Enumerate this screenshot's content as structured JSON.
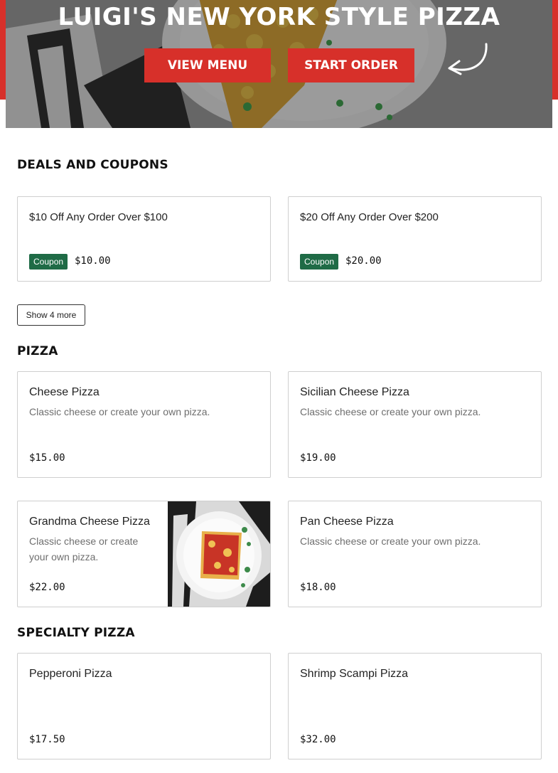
{
  "hero": {
    "title": "LUIGI'S NEW YORK STYLE PIZZA",
    "view_menu_label": "VIEW MENU",
    "start_order_label": "START ORDER"
  },
  "deals": {
    "title": "DEALS AND COUPONS",
    "items": [
      {
        "name": "$10 Off Any Order Over $100",
        "badge": "Coupon",
        "price": "$10.00"
      },
      {
        "name": "$20 Off Any Order Over $200",
        "badge": "Coupon",
        "price": "$20.00"
      }
    ],
    "show_more_label": "Show 4 more"
  },
  "pizza": {
    "title": "PIZZA",
    "items": [
      {
        "name": "Cheese Pizza",
        "desc": "Classic cheese or create your own pizza.",
        "price": "$15.00"
      },
      {
        "name": "Sicilian Cheese Pizza",
        "desc": "Classic cheese or create your own pizza.",
        "price": "$19.00"
      },
      {
        "name": "Grandma Cheese Pizza",
        "desc_line1": "Classic cheese or create",
        "desc_line2": "your own pizza.",
        "price": "$22.00"
      },
      {
        "name": "Pan Cheese Pizza",
        "desc": "Classic cheese or create your own pizza.",
        "price": "$18.00"
      }
    ]
  },
  "specialty": {
    "title": "SPECIALTY PIZZA",
    "items": [
      {
        "name": "Pepperoni Pizza",
        "price": "$17.50"
      },
      {
        "name": "Shrimp Scampi Pizza",
        "price": "$32.00"
      }
    ]
  },
  "colors": {
    "brand_red": "#d7302a",
    "coupon_green": "#1f6b46"
  }
}
